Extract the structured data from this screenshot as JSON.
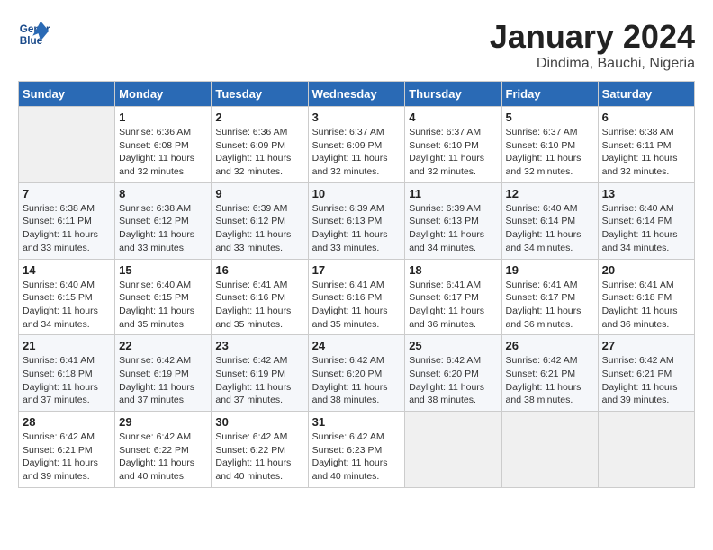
{
  "header": {
    "logo_line1": "General",
    "logo_line2": "Blue",
    "month": "January 2024",
    "location": "Dindima, Bauchi, Nigeria"
  },
  "days_of_week": [
    "Sunday",
    "Monday",
    "Tuesday",
    "Wednesday",
    "Thursday",
    "Friday",
    "Saturday"
  ],
  "weeks": [
    [
      {
        "day": "",
        "info": ""
      },
      {
        "day": "1",
        "info": "Sunrise: 6:36 AM\nSunset: 6:08 PM\nDaylight: 11 hours\nand 32 minutes."
      },
      {
        "day": "2",
        "info": "Sunrise: 6:36 AM\nSunset: 6:09 PM\nDaylight: 11 hours\nand 32 minutes."
      },
      {
        "day": "3",
        "info": "Sunrise: 6:37 AM\nSunset: 6:09 PM\nDaylight: 11 hours\nand 32 minutes."
      },
      {
        "day": "4",
        "info": "Sunrise: 6:37 AM\nSunset: 6:10 PM\nDaylight: 11 hours\nand 32 minutes."
      },
      {
        "day": "5",
        "info": "Sunrise: 6:37 AM\nSunset: 6:10 PM\nDaylight: 11 hours\nand 32 minutes."
      },
      {
        "day": "6",
        "info": "Sunrise: 6:38 AM\nSunset: 6:11 PM\nDaylight: 11 hours\nand 32 minutes."
      }
    ],
    [
      {
        "day": "7",
        "info": "Sunrise: 6:38 AM\nSunset: 6:11 PM\nDaylight: 11 hours\nand 33 minutes."
      },
      {
        "day": "8",
        "info": "Sunrise: 6:38 AM\nSunset: 6:12 PM\nDaylight: 11 hours\nand 33 minutes."
      },
      {
        "day": "9",
        "info": "Sunrise: 6:39 AM\nSunset: 6:12 PM\nDaylight: 11 hours\nand 33 minutes."
      },
      {
        "day": "10",
        "info": "Sunrise: 6:39 AM\nSunset: 6:13 PM\nDaylight: 11 hours\nand 33 minutes."
      },
      {
        "day": "11",
        "info": "Sunrise: 6:39 AM\nSunset: 6:13 PM\nDaylight: 11 hours\nand 34 minutes."
      },
      {
        "day": "12",
        "info": "Sunrise: 6:40 AM\nSunset: 6:14 PM\nDaylight: 11 hours\nand 34 minutes."
      },
      {
        "day": "13",
        "info": "Sunrise: 6:40 AM\nSunset: 6:14 PM\nDaylight: 11 hours\nand 34 minutes."
      }
    ],
    [
      {
        "day": "14",
        "info": "Sunrise: 6:40 AM\nSunset: 6:15 PM\nDaylight: 11 hours\nand 34 minutes."
      },
      {
        "day": "15",
        "info": "Sunrise: 6:40 AM\nSunset: 6:15 PM\nDaylight: 11 hours\nand 35 minutes."
      },
      {
        "day": "16",
        "info": "Sunrise: 6:41 AM\nSunset: 6:16 PM\nDaylight: 11 hours\nand 35 minutes."
      },
      {
        "day": "17",
        "info": "Sunrise: 6:41 AM\nSunset: 6:16 PM\nDaylight: 11 hours\nand 35 minutes."
      },
      {
        "day": "18",
        "info": "Sunrise: 6:41 AM\nSunset: 6:17 PM\nDaylight: 11 hours\nand 36 minutes."
      },
      {
        "day": "19",
        "info": "Sunrise: 6:41 AM\nSunset: 6:17 PM\nDaylight: 11 hours\nand 36 minutes."
      },
      {
        "day": "20",
        "info": "Sunrise: 6:41 AM\nSunset: 6:18 PM\nDaylight: 11 hours\nand 36 minutes."
      }
    ],
    [
      {
        "day": "21",
        "info": "Sunrise: 6:41 AM\nSunset: 6:18 PM\nDaylight: 11 hours\nand 37 minutes."
      },
      {
        "day": "22",
        "info": "Sunrise: 6:42 AM\nSunset: 6:19 PM\nDaylight: 11 hours\nand 37 minutes."
      },
      {
        "day": "23",
        "info": "Sunrise: 6:42 AM\nSunset: 6:19 PM\nDaylight: 11 hours\nand 37 minutes."
      },
      {
        "day": "24",
        "info": "Sunrise: 6:42 AM\nSunset: 6:20 PM\nDaylight: 11 hours\nand 38 minutes."
      },
      {
        "day": "25",
        "info": "Sunrise: 6:42 AM\nSunset: 6:20 PM\nDaylight: 11 hours\nand 38 minutes."
      },
      {
        "day": "26",
        "info": "Sunrise: 6:42 AM\nSunset: 6:21 PM\nDaylight: 11 hours\nand 38 minutes."
      },
      {
        "day": "27",
        "info": "Sunrise: 6:42 AM\nSunset: 6:21 PM\nDaylight: 11 hours\nand 39 minutes."
      }
    ],
    [
      {
        "day": "28",
        "info": "Sunrise: 6:42 AM\nSunset: 6:21 PM\nDaylight: 11 hours\nand 39 minutes."
      },
      {
        "day": "29",
        "info": "Sunrise: 6:42 AM\nSunset: 6:22 PM\nDaylight: 11 hours\nand 40 minutes."
      },
      {
        "day": "30",
        "info": "Sunrise: 6:42 AM\nSunset: 6:22 PM\nDaylight: 11 hours\nand 40 minutes."
      },
      {
        "day": "31",
        "info": "Sunrise: 6:42 AM\nSunset: 6:23 PM\nDaylight: 11 hours\nand 40 minutes."
      },
      {
        "day": "",
        "info": ""
      },
      {
        "day": "",
        "info": ""
      },
      {
        "day": "",
        "info": ""
      }
    ]
  ]
}
